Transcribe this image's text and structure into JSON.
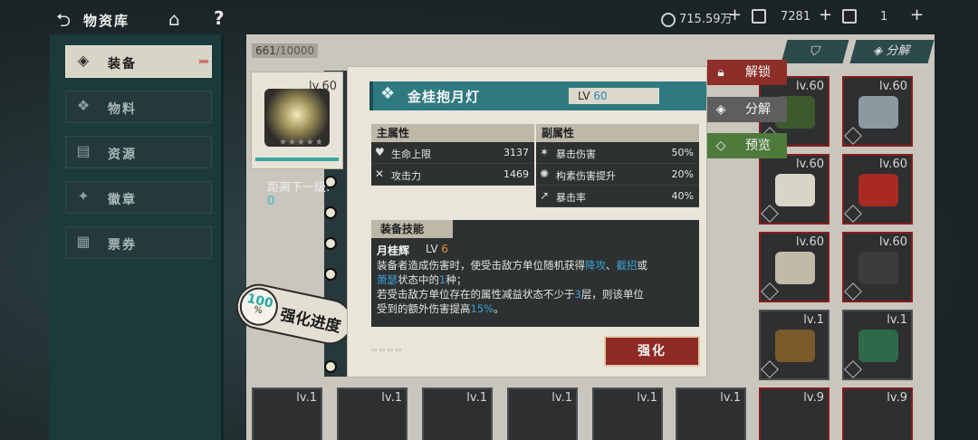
{
  "header": {
    "title": "物资库",
    "resources": [
      {
        "icon": "coin-icon",
        "value": "715.59万"
      },
      {
        "icon": "ticket-icon",
        "value": "7281"
      },
      {
        "icon": "card-icon",
        "value": "1"
      }
    ]
  },
  "sidebar": {
    "items": [
      {
        "label": "装备",
        "icon": "equipment-icon",
        "active": true
      },
      {
        "label": "物料",
        "icon": "materials-icon",
        "active": false
      },
      {
        "label": "资源",
        "icon": "resources-icon",
        "active": false
      },
      {
        "label": "徽章",
        "icon": "badge-icon",
        "active": false
      },
      {
        "label": "票券",
        "icon": "voucher-icon",
        "active": false
      }
    ]
  },
  "inventory": {
    "capacity_current": "661",
    "capacity_max": "/10000",
    "filter_label": "▼",
    "decompose_label": "分解",
    "visible_levels": [
      "lv.60",
      "lv.60",
      "lv.60",
      "lv.60",
      "lv.60",
      "lv.60",
      "lv.1",
      "lv.1",
      "lv.1",
      "lv.1",
      "lv.1",
      "lv.1",
      "lv.1",
      "lv.1",
      "lv.9",
      "lv.9"
    ]
  },
  "selected_item": {
    "level": "lv.60",
    "next_level_label": "距离下一级:",
    "next_level_value": "0",
    "progress_percent": "100",
    "progress_symbol": "%",
    "progress_label": "强化进度"
  },
  "detail": {
    "name": "金桂抱月灯",
    "level_prefix": "LV",
    "level_value": "60",
    "main_attr_title": "主属性",
    "main_attrs": [
      {
        "icon": "heart-icon",
        "name": "生命上限",
        "value": "3137"
      },
      {
        "icon": "swords-icon",
        "name": "攻击力",
        "value": "1469"
      }
    ],
    "sub_attr_title": "副属性",
    "sub_attrs": [
      {
        "icon": "crit-damage-icon",
        "name": "暴击伤害",
        "value": "50%"
      },
      {
        "icon": "construct-damage-icon",
        "name": "构素伤害提升",
        "value": "20%"
      },
      {
        "icon": "crit-rate-icon",
        "name": "暴击率",
        "value": "40%"
      }
    ],
    "skill_section_title": "装备技能",
    "skill_name": "月桂辉",
    "skill_lv_prefix": "LV",
    "skill_lv_value": "6",
    "skill_desc_1a": "装备者造成伤害时，使受击敌方单位随机获得",
    "skill_desc_1b": "降攻",
    "skill_desc_1c": "、",
    "skill_desc_1d": "截招",
    "skill_desc_1e": "或",
    "skill_desc_2a": "萧瑟",
    "skill_desc_2b": "状态中的",
    "skill_desc_2c": "1",
    "skill_desc_2d": "种；",
    "skill_desc_3a": "若受击敌方单位存在的属性减益状态不少于",
    "skill_desc_3b": "3",
    "skill_desc_3c": "层，则该单位",
    "skill_desc_4a": "受到的额外伤害提高",
    "skill_desc_4b": "15%",
    "skill_desc_4c": "。",
    "upgrade_label": "强化"
  },
  "side_actions": {
    "unlock_label": "解锁",
    "decompose_label": "分解",
    "preview_label": "预览"
  },
  "colors": {
    "accent_teal": "#2f7a80",
    "highlight_blue": "#3aa3d8",
    "upgrade_red": "#8f2a24",
    "preview_green": "#4e7a3c"
  }
}
